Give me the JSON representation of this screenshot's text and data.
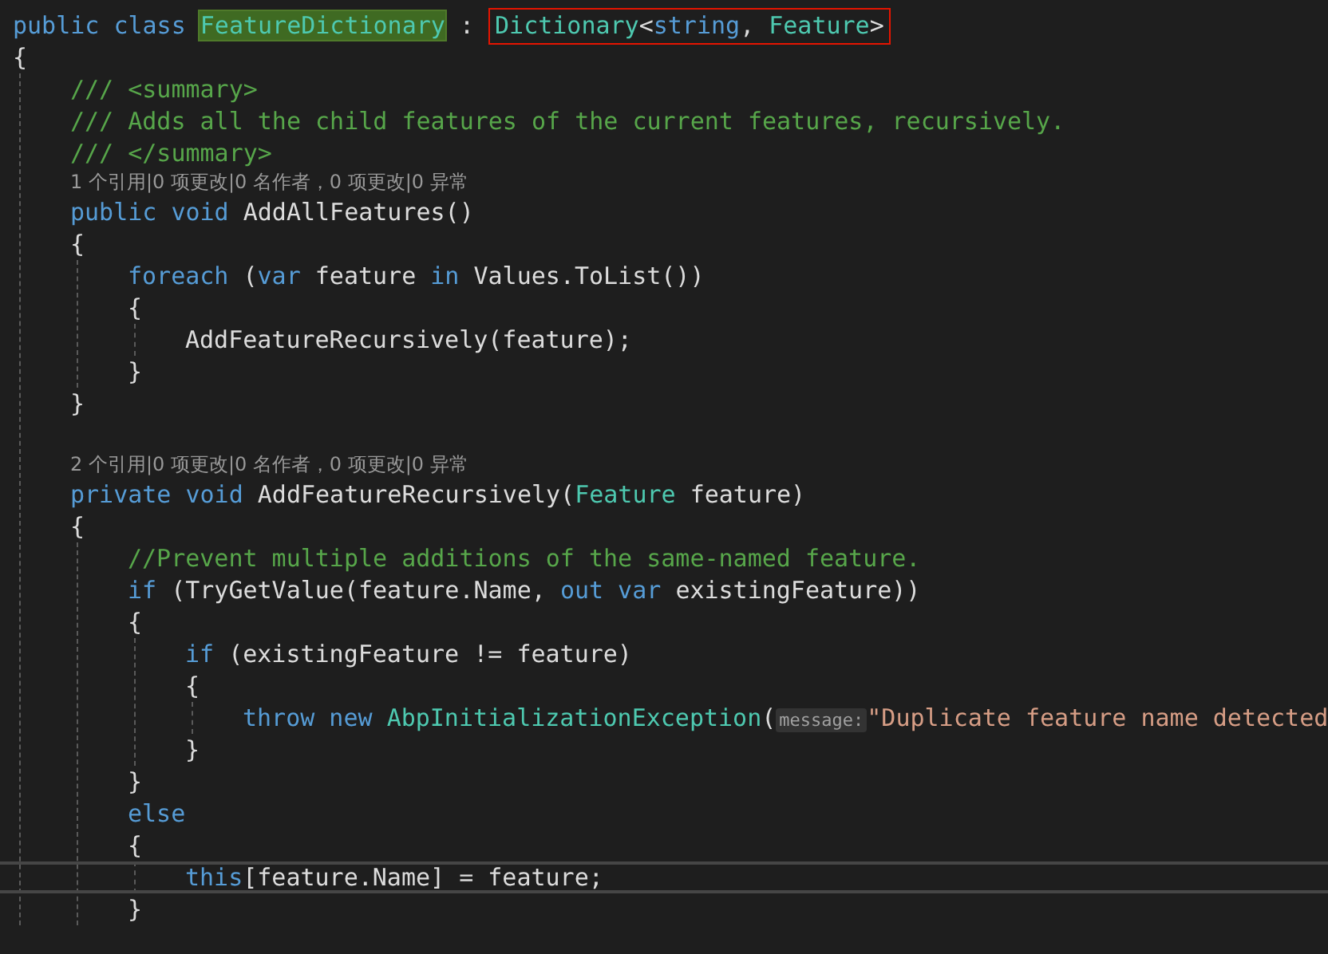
{
  "editor": {
    "lines": [
      {
        "kind": "line",
        "tokens": [
          {
            "kind": "kw",
            "text": "public class "
          },
          {
            "kind": "type",
            "text": "FeatureDictionary",
            "highlighted": true
          },
          {
            "kind": "plain",
            "text": " : "
          },
          {
            "kind": "box",
            "children": [
              {
                "kind": "type",
                "text": "Dictionary"
              },
              {
                "kind": "plain",
                "text": "<"
              },
              {
                "kind": "kw",
                "text": "string"
              },
              {
                "kind": "plain",
                "text": ", "
              },
              {
                "kind": "type",
                "text": "Feature"
              },
              {
                "kind": "plain",
                "text": ">"
              }
            ]
          }
        ]
      },
      {
        "kind": "line",
        "tokens": [
          {
            "kind": "plain",
            "text": "{"
          }
        ]
      },
      {
        "kind": "block",
        "children": [
          {
            "kind": "line",
            "tokens": [
              {
                "kind": "doc",
                "text": "/// <summary>"
              }
            ]
          },
          {
            "kind": "line",
            "tokens": [
              {
                "kind": "doc",
                "text": "/// Adds all the child features of the current features, recursively."
              }
            ]
          },
          {
            "kind": "line",
            "tokens": [
              {
                "kind": "doc",
                "text": "/// </summary>"
              }
            ]
          },
          {
            "kind": "lens",
            "text": "1 个引用|0 项更改|0 名作者，0 项更改|0 异常"
          },
          {
            "kind": "line",
            "tokens": [
              {
                "kind": "kw",
                "text": "public void "
              },
              {
                "kind": "plain",
                "text": "AddAllFeatures()"
              }
            ]
          },
          {
            "kind": "line",
            "tokens": [
              {
                "kind": "plain",
                "text": "{"
              }
            ]
          },
          {
            "kind": "block",
            "children": [
              {
                "kind": "line",
                "tokens": [
                  {
                    "kind": "kw",
                    "text": "foreach "
                  },
                  {
                    "kind": "plain",
                    "text": "("
                  },
                  {
                    "kind": "kw",
                    "text": "var "
                  },
                  {
                    "kind": "plain",
                    "text": "feature "
                  },
                  {
                    "kind": "kw",
                    "text": "in "
                  },
                  {
                    "kind": "plain",
                    "text": "Values.ToList())"
                  }
                ]
              },
              {
                "kind": "line",
                "tokens": [
                  {
                    "kind": "plain",
                    "text": "{"
                  }
                ]
              },
              {
                "kind": "block",
                "children": [
                  {
                    "kind": "line",
                    "tokens": [
                      {
                        "kind": "plain",
                        "text": "AddFeatureRecursively(feature);"
                      }
                    ]
                  }
                ]
              },
              {
                "kind": "line",
                "tokens": [
                  {
                    "kind": "plain",
                    "text": "}"
                  }
                ]
              }
            ]
          },
          {
            "kind": "line",
            "tokens": [
              {
                "kind": "plain",
                "text": "}"
              }
            ]
          },
          {
            "kind": "blank"
          },
          {
            "kind": "lens",
            "text": "2 个引用|0 项更改|0 名作者，0 项更改|0 异常"
          },
          {
            "kind": "line",
            "tokens": [
              {
                "kind": "kw",
                "text": "private void "
              },
              {
                "kind": "plain",
                "text": "AddFeatureRecursively("
              },
              {
                "kind": "type",
                "text": "Feature "
              },
              {
                "kind": "plain",
                "text": "feature)"
              }
            ]
          },
          {
            "kind": "line",
            "tokens": [
              {
                "kind": "plain",
                "text": "{"
              }
            ]
          },
          {
            "kind": "block",
            "children": [
              {
                "kind": "line",
                "tokens": [
                  {
                    "kind": "comment",
                    "text": "//Prevent multiple additions of the same-named feature."
                  }
                ]
              },
              {
                "kind": "line",
                "tokens": [
                  {
                    "kind": "kw",
                    "text": "if "
                  },
                  {
                    "kind": "plain",
                    "text": "(TryGetValue(feature.Name, "
                  },
                  {
                    "kind": "kw",
                    "text": "out var "
                  },
                  {
                    "kind": "plain",
                    "text": "existingFeature))"
                  }
                ]
              },
              {
                "kind": "line",
                "tokens": [
                  {
                    "kind": "plain",
                    "text": "{"
                  }
                ]
              },
              {
                "kind": "block",
                "children": [
                  {
                    "kind": "line",
                    "tokens": [
                      {
                        "kind": "kw",
                        "text": "if "
                      },
                      {
                        "kind": "plain",
                        "text": "(existingFeature != feature)"
                      }
                    ]
                  },
                  {
                    "kind": "line",
                    "tokens": [
                      {
                        "kind": "plain",
                        "text": "{"
                      }
                    ]
                  },
                  {
                    "kind": "block",
                    "children": [
                      {
                        "kind": "line",
                        "tokens": [
                          {
                            "kind": "kw",
                            "text": "throw new "
                          },
                          {
                            "kind": "type",
                            "text": "AbpInitializationException"
                          },
                          {
                            "kind": "plain",
                            "text": "("
                          },
                          {
                            "kind": "hint",
                            "text": "message:"
                          },
                          {
                            "kind": "string",
                            "text": "\"Duplicate feature name detected"
                          }
                        ]
                      }
                    ]
                  },
                  {
                    "kind": "line",
                    "tokens": [
                      {
                        "kind": "plain",
                        "text": "}"
                      }
                    ]
                  }
                ]
              },
              {
                "kind": "line",
                "tokens": [
                  {
                    "kind": "plain",
                    "text": "}"
                  }
                ]
              },
              {
                "kind": "line",
                "tokens": [
                  {
                    "kind": "kw",
                    "text": "else"
                  }
                ]
              },
              {
                "kind": "line",
                "tokens": [
                  {
                    "kind": "plain",
                    "text": "{"
                  }
                ]
              },
              {
                "kind": "block",
                "children": [
                  {
                    "kind": "line",
                    "current": true,
                    "tokens": [
                      {
                        "kind": "kw",
                        "text": "this"
                      },
                      {
                        "kind": "plain",
                        "text": "[feature.Name] = feature;"
                      }
                    ]
                  }
                ]
              },
              {
                "kind": "line",
                "tokens": [
                  {
                    "kind": "plain",
                    "text": "}"
                  }
                ]
              }
            ]
          }
        ]
      }
    ]
  }
}
